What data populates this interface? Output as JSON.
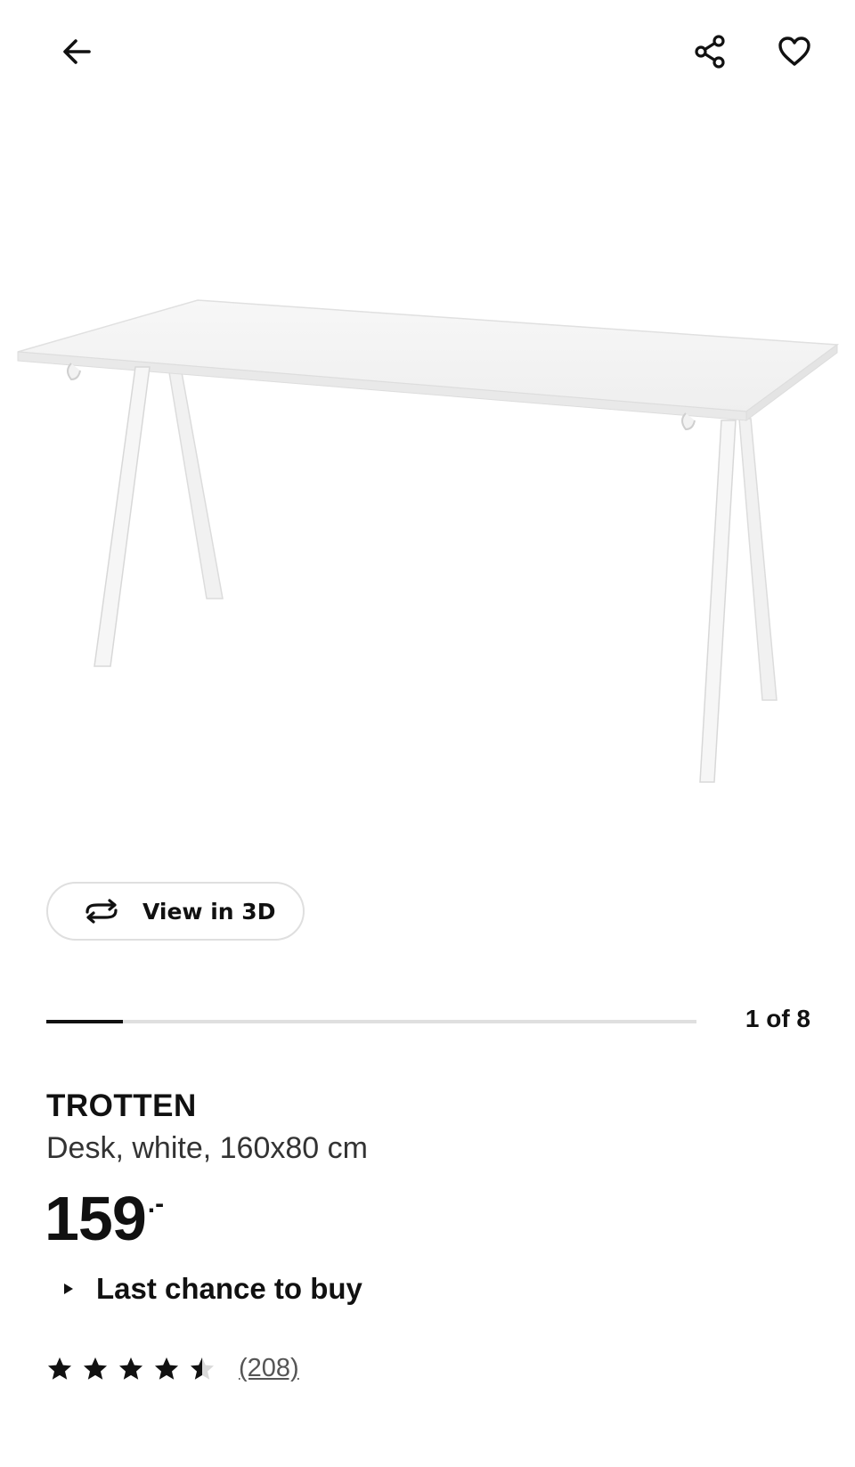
{
  "header": {
    "back_icon": "arrow-left-icon",
    "share_icon": "share-icon",
    "favorite_icon": "heart-outline-icon"
  },
  "gallery": {
    "view3d_label": "View in 3D",
    "view3d_icon": "rotate-3d-icon",
    "position_label": "1 of 8",
    "current_index": 1,
    "total_images": 8
  },
  "product": {
    "name": "TROTTEN",
    "description": "Desk, white, 160x80 cm",
    "price": "159",
    "price_suffix": ".-",
    "availability": "Last chance to buy",
    "rating": 4.5,
    "rating_max": 5,
    "review_count": "(208)"
  },
  "colors": {
    "text": "#111111",
    "border": "#dfdfdf",
    "star": "#111111"
  }
}
